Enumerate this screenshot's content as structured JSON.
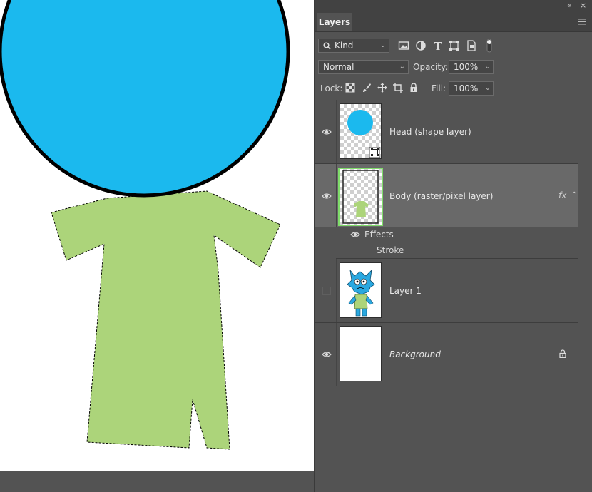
{
  "panel": {
    "collapse_glyph": "«",
    "close_glyph": "×",
    "tab_label": "Layers",
    "menu_icon": "hamburger-menu-icon"
  },
  "filter": {
    "kind_value": "Kind",
    "filter_icons": [
      "image-filter-icon",
      "adjustment-filter-icon",
      "type-filter-icon",
      "shape-filter-icon",
      "smart-object-filter-icon",
      "filter-toggle-icon"
    ]
  },
  "blend": {
    "mode_value": "Normal",
    "opacity_label": "Opacity:",
    "opacity_value": "100%",
    "lock_label": "Lock:",
    "fill_label": "Fill:",
    "fill_value": "100%",
    "lock_icons": [
      "lock-transparent-pixels-icon",
      "lock-image-pixels-icon",
      "lock-position-icon",
      "lock-artboard-icon",
      "lock-all-icon"
    ]
  },
  "layers": [
    {
      "name": "Head (shape layer)",
      "visible": true,
      "selected": false
    },
    {
      "name": "Body (raster/pixel layer)",
      "visible": true,
      "selected": true,
      "fx": "fx",
      "effects_label": "Effects",
      "effect_items": [
        "Stroke"
      ]
    },
    {
      "name": "Layer 1",
      "visible": false,
      "selected": false
    },
    {
      "name": "Background",
      "visible": true,
      "selected": false,
      "locked": true
    }
  ],
  "colors": {
    "head_fill": "#1bb9ee",
    "body_fill": "#acd47a",
    "panel_bg": "#535353",
    "selected_row": "#696969",
    "selection_outline": "#7fdd6a"
  }
}
